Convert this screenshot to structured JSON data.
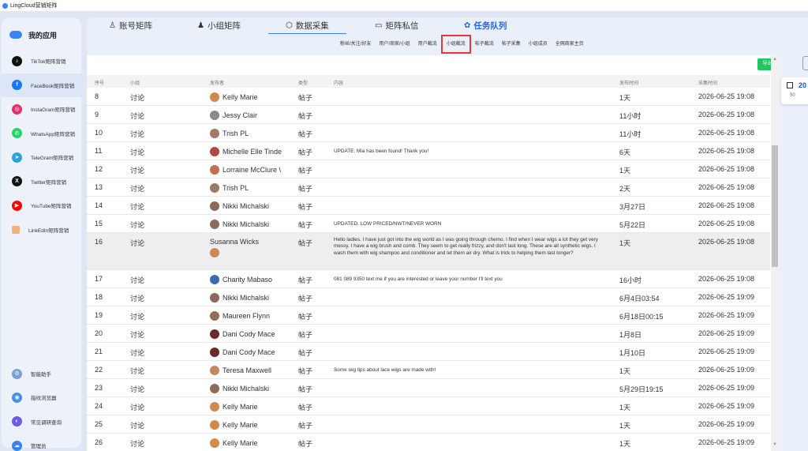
{
  "window": {
    "title": "LingCloud营销矩阵"
  },
  "sidebar": {
    "app_title": "我的应用",
    "items": [
      {
        "label": "TikTok矩阵营销",
        "icon": "tiktok-icon",
        "color": "#111111",
        "glyph": "♪"
      },
      {
        "label": "FaceBook矩阵营销",
        "icon": "facebook-icon",
        "color": "#1877f2",
        "glyph": "f"
      },
      {
        "label": "InstaGram矩阵营销",
        "icon": "instagram-icon",
        "color": "#e1306c",
        "glyph": "◎"
      },
      {
        "label": "WhatsApp矩阵营销",
        "icon": "whatsapp-icon",
        "color": "#25d366",
        "glyph": "✆"
      },
      {
        "label": "TeleGram矩阵营销",
        "icon": "telegram-icon",
        "color": "#2aa3df",
        "glyph": "➤"
      },
      {
        "label": "Twitter矩阵营销",
        "icon": "twitter-x-icon",
        "color": "#111111",
        "glyph": "X"
      },
      {
        "label": "YouTube矩阵营销",
        "icon": "youtube-icon",
        "color": "#ff0000",
        "glyph": "▶"
      },
      {
        "label": "LinkEdIn矩阵营销",
        "icon": "linkedin-icon",
        "color": "#f0b27a",
        "glyph": ""
      }
    ],
    "bottom_items": [
      {
        "label": "智能助手",
        "icon": "assistant-gear-icon",
        "color": "#7aa0d6",
        "glyph": "⚙"
      },
      {
        "label": "指纹浏览器",
        "icon": "fingerprint-browser-icon",
        "color": "#4a8fe0",
        "glyph": "◉"
      },
      {
        "label": "常见调研查询",
        "icon": "survey-query-icon",
        "color": "#6c5ce7",
        "glyph": "◐"
      },
      {
        "label": "管理员",
        "icon": "admin-icon",
        "color": "#3b82f6",
        "glyph": "☁"
      }
    ],
    "active_index": 1
  },
  "tabs": [
    {
      "label": "账号矩阵",
      "icon": "person-icon",
      "glyph": "♙"
    },
    {
      "label": "小组矩阵",
      "icon": "group-icon",
      "glyph": "♟"
    },
    {
      "label": "数据采集",
      "icon": "cube-icon",
      "glyph": "⬡"
    },
    {
      "label": "矩阵私信",
      "icon": "message-icon",
      "glyph": "▭"
    },
    {
      "label": "任务队列",
      "icon": "gear-queue-icon",
      "glyph": "✿"
    }
  ],
  "subtabs": [
    "粉丝/关注/好友",
    "用户/商家/小组",
    "用户截流",
    "小组截流",
    "帖子截流",
    "帖子采集",
    "小组成员",
    "全网商家主页"
  ],
  "subtab_selected": "小组截流",
  "toolbar": {
    "export_label": "导出"
  },
  "table": {
    "headers": {
      "num": "序号",
      "group": "小组",
      "publisher": "发布者",
      "type": "类型",
      "content": "内容",
      "pub_time": "发布时间",
      "collect_time": "采集时间"
    },
    "rows": [
      {
        "num": "8",
        "group": "讨论",
        "publisher": "Kelly Marie",
        "type": "帖子",
        "content": "",
        "pub_time": "1天",
        "collect_time": "2026-06-25 19:08",
        "avatar": "#d08a4c"
      },
      {
        "num": "9",
        "group": "讨论",
        "publisher": "Jessy Clair",
        "type": "帖子",
        "content": "",
        "pub_time": "11小时",
        "collect_time": "2026-06-25 19:08",
        "avatar": "#8a8a8a"
      },
      {
        "num": "10",
        "group": "讨论",
        "publisher": "Trish PL",
        "type": "帖子",
        "content": "",
        "pub_time": "11小时",
        "collect_time": "2026-06-25 19:08",
        "avatar": "#a07a66"
      },
      {
        "num": "11",
        "group": "讨论",
        "publisher": "Michelle Elle Tinde",
        "type": "帖子",
        "content": "UPDATE:  Mia has been found! Thank you!",
        "pub_time": "6天",
        "collect_time": "2026-06-25 19:08",
        "avatar": "#b04a3a"
      },
      {
        "num": "12",
        "group": "讨论",
        "publisher": "Lorraine McClure \\",
        "type": "帖子",
        "content": "",
        "pub_time": "1天",
        "collect_time": "2026-06-25 19:08",
        "avatar": "#c07050"
      },
      {
        "num": "13",
        "group": "讨论",
        "publisher": "Trish PL",
        "type": "帖子",
        "content": "",
        "pub_time": "2天",
        "collect_time": "2026-06-25 19:08",
        "avatar": "#a07a66"
      },
      {
        "num": "14",
        "group": "讨论",
        "publisher": "Nikki Michalski",
        "type": "帖子",
        "content": "",
        "pub_time": "3月27日",
        "collect_time": "2026-06-25 19:08",
        "avatar": "#8c6a5a"
      },
      {
        "num": "15",
        "group": "讨论",
        "publisher": "Nikki Michalski",
        "type": "帖子",
        "content": "UPDATED. LOW PRICED/NWT/NEVER WORN",
        "pub_time": "5月22日",
        "collect_time": "2026-06-25 19:08",
        "avatar": "#8c6a5a"
      },
      {
        "num": "16",
        "group": "讨论",
        "publisher": "Susanna Wicks",
        "type": "帖子",
        "content": "Hello ladies. I have just got into the wig world as I was going through chemo. I find when I wear wigs a lot they get very messy. I have a wig brush and comb. They seem to get really frizzy, and don't last long. These are all synthetic wigs. I wash them with wig shampoo and conditioner and let them air dry. What is trick to helping them last longer?",
        "pub_time": "1天",
        "collect_time": "2026-06-25 19:08",
        "avatar": "#c98a5a",
        "tall": true
      },
      {
        "num": "17",
        "group": "讨论",
        "publisher": "Charity Mabaso",
        "type": "帖子",
        "content": "081 089 9350 text me if you are interested or leave your number I'll text you",
        "pub_time": "16小时",
        "collect_time": "2026-06-25 19:08",
        "avatar": "#3a6cb0"
      },
      {
        "num": "18",
        "group": "讨论",
        "publisher": "Nikki Michalski",
        "type": "帖子",
        "content": "",
        "pub_time": "6月4日03:54",
        "collect_time": "2026-06-25 19:09",
        "avatar": "#8c6a5a"
      },
      {
        "num": "19",
        "group": "讨论",
        "publisher": "Maureen Flynn",
        "type": "帖子",
        "content": "",
        "pub_time": "6月18日00:15",
        "collect_time": "2026-06-25 19:09",
        "avatar": "#9a6a5a"
      },
      {
        "num": "20",
        "group": "讨论",
        "publisher": "Dani Cody Mace",
        "type": "帖子",
        "content": "",
        "pub_time": "1月8日",
        "collect_time": "2026-06-25 19:09",
        "avatar": "#6a2a2a"
      },
      {
        "num": "21",
        "group": "讨论",
        "publisher": "Dani Cody Mace",
        "type": "帖子",
        "content": "",
        "pub_time": "1月10日",
        "collect_time": "2026-06-25 19:09",
        "avatar": "#6a2a2a"
      },
      {
        "num": "22",
        "group": "讨论",
        "publisher": "Teresa Maxwell",
        "type": "帖子",
        "content": "Some wig tips about lace wigs are made with!",
        "pub_time": "1天",
        "collect_time": "2026-06-25 19:09",
        "avatar": "#c08a60"
      },
      {
        "num": "23",
        "group": "讨论",
        "publisher": "Nikki Michalski",
        "type": "帖子",
        "content": "",
        "pub_time": "5月29日19:15",
        "collect_time": "2026-06-25 19:09",
        "avatar": "#8c6a5a"
      },
      {
        "num": "24",
        "group": "讨论",
        "publisher": "Kelly Marie",
        "type": "帖子",
        "content": "",
        "pub_time": "1天",
        "collect_time": "2026-06-25 19:09",
        "avatar": "#d08a4c"
      },
      {
        "num": "25",
        "group": "讨论",
        "publisher": "Kelly Marie",
        "type": "帖子",
        "content": "",
        "pub_time": "1天",
        "collect_time": "2026-06-25 19:09",
        "avatar": "#d08a4c"
      },
      {
        "num": "26",
        "group": "讨论",
        "publisher": "Kelly Marie",
        "type": "帖子",
        "content": "",
        "pub_time": "1天",
        "collect_time": "2026-06-25 19:09",
        "avatar": "#d08a4c"
      }
    ]
  },
  "right_panel": {
    "value": "20",
    "sub": "50"
  },
  "colors": {
    "accent": "#3b82f6",
    "export": "#22c55e",
    "highlight": "#e53935"
  }
}
